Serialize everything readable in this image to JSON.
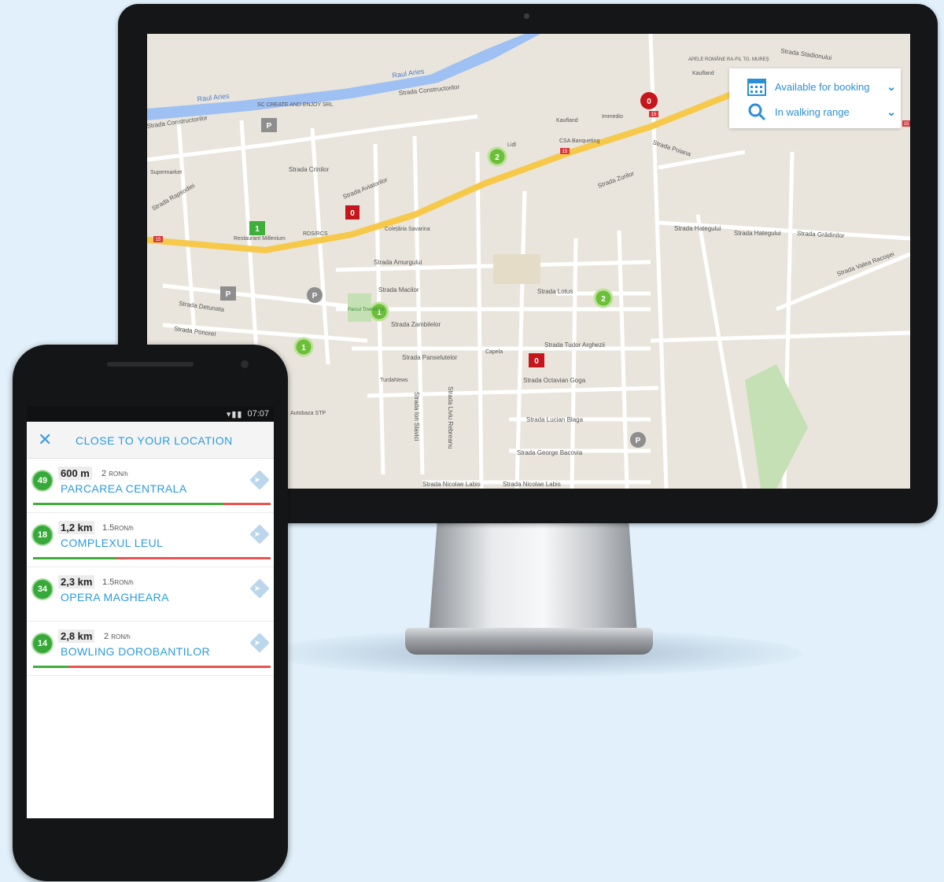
{
  "colors": {
    "accent": "#2a9ae0",
    "green": "#36a93a",
    "red": "#e8544f",
    "map_bg": "#e9e5dc",
    "road_yellow": "#f6c94a",
    "river": "#8fb8f0"
  },
  "map": {
    "filters": [
      {
        "label": "Available for booking",
        "icon": "calendar-icon"
      },
      {
        "label": "In walking range",
        "icon": "search-icon"
      }
    ],
    "street_labels": [
      "Raul Aries",
      "Raul Aries",
      "Strada Constructorilor",
      "Strada Constructorilor",
      "SC CREATE AND ENJOY SRL",
      "Strada Crinilor",
      "Strada Aviatorilor",
      "Strada Rapsodiei",
      "RDS/RCS",
      "Colețăria Savarina",
      "Strada Amurgului",
      "Strada Macilor",
      "Strada Detunata",
      "Strada Ponorel",
      "Strada Zambilelor",
      "Strada Panselutelor",
      "TurdaNews",
      "Autobaza STP",
      "Strada Lotus",
      "Capela",
      "Strada Tudor Arghezii",
      "Strada Octavian Goga",
      "Strada Lucian Blaga",
      "Strada George Bacovia",
      "Strada Nicolae Labis",
      "Strada Nicolae Labis",
      "Strada Zorilor",
      "Strada Poiana",
      "Strada Hategului",
      "Strada Hategului",
      "Strada Grădinilor",
      "Strada Valea Racoșei",
      "Strada Stadionului",
      "APELE ROMÂNE RA-FIL TG. MUREȘ",
      "Kaufland",
      "Kaufland",
      "Immedio",
      "CSA Banqueting",
      "Lidl",
      "Parcul Tineretului",
      "Restaurant Millenium",
      "Supermarket",
      "Strada Ion Slavici",
      "Strada Liviu Rebreanu"
    ],
    "markers": [
      {
        "kind": "green",
        "count": "2"
      },
      {
        "kind": "green",
        "count": "1"
      },
      {
        "kind": "green",
        "count": "1"
      },
      {
        "kind": "green",
        "count": "2"
      },
      {
        "kind": "green",
        "count": "1"
      },
      {
        "kind": "red",
        "count": "0"
      },
      {
        "kind": "red",
        "count": "0"
      },
      {
        "kind": "red",
        "count": "0"
      },
      {
        "kind": "gray",
        "count": "P"
      },
      {
        "kind": "gray",
        "count": "P"
      },
      {
        "kind": "gray",
        "count": "P"
      },
      {
        "kind": "gray",
        "count": "P"
      }
    ],
    "road_numbers": [
      "15",
      "15",
      "15",
      "15"
    ]
  },
  "phone": {
    "status": {
      "time": "07:07",
      "icons": "wifi-signal-battery"
    },
    "header": {
      "close_icon": "✕",
      "title": "CLOSE TO YOUR LOCATION"
    },
    "list": [
      {
        "spots": "49",
        "distance": "600 m",
        "price": "2",
        "unit": "RON/h",
        "name": "PARCAREA CENTRALA",
        "occupancy": 0.8
      },
      {
        "spots": "18",
        "distance": "1,2 km",
        "price": "1.5",
        "unit": "RON/h",
        "name": "COMPLEXUL LEUL",
        "occupancy": 0.35
      },
      {
        "spots": "34",
        "distance": "2,3 km",
        "price": "1.5",
        "unit": "RON/h",
        "name": "OPERA MAGHEARA",
        "occupancy": 0.0
      },
      {
        "spots": "14",
        "distance": "2,8 km",
        "price": "2",
        "unit": "RON/h",
        "name": "BOWLING DOROBANTILOR",
        "occupancy": 0.15
      }
    ]
  }
}
